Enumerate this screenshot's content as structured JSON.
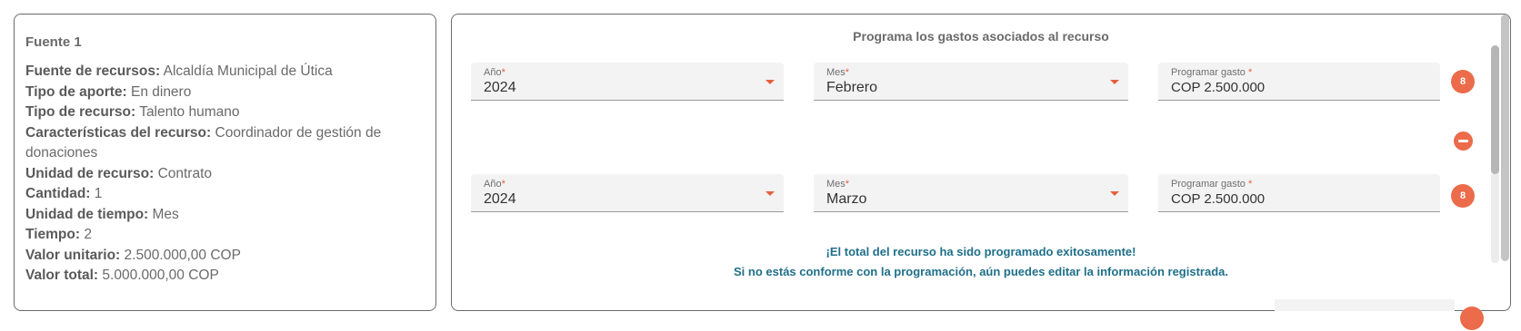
{
  "source_card": {
    "title": "Fuente 1",
    "rows": [
      {
        "label": "Fuente de recursos:",
        "value": "Alcaldía Municipal de Útica"
      },
      {
        "label": "Tipo de aporte:",
        "value": "En dinero"
      },
      {
        "label": "Tipo de recurso:",
        "value": "Talento humano"
      },
      {
        "label": "Características del recurso:",
        "value": "Coordinador de gestión de donaciones"
      },
      {
        "label": "Unidad de recurso:",
        "value": "Contrato"
      },
      {
        "label": "Cantidad:",
        "value": "1"
      },
      {
        "label": "Unidad de tiempo:",
        "value": "Mes"
      },
      {
        "label": "Tiempo:",
        "value": "2"
      },
      {
        "label": "Valor unitario:",
        "value": "2.500.000,00 COP"
      },
      {
        "label": "Valor total:",
        "value": "5.000.000,00 COP"
      }
    ]
  },
  "program": {
    "title": "Programa los gastos asociados al recurso",
    "entries": [
      {
        "year_label": "Año",
        "year": "2024",
        "month_label": "Mes",
        "month": "Febrero",
        "amount_label": "Programar gasto",
        "amount": "COP 2.500.000",
        "badge": "8"
      },
      {
        "year_label": "Año",
        "year": "2024",
        "month_label": "Mes",
        "month": "Marzo",
        "amount_label": "Programar gasto",
        "amount": "COP 2.500.000",
        "badge": "8"
      }
    ],
    "required_mark": "*",
    "success_line1": "¡El total del recurso ha sido programado exitosamente!",
    "success_line2": "Si no estás conforme con la programación, aún puedes editar la información registrada."
  },
  "colors": {
    "accent": "#ec6b4a",
    "success_text": "#1f6f8a",
    "field_bg": "#f3f3f3"
  }
}
